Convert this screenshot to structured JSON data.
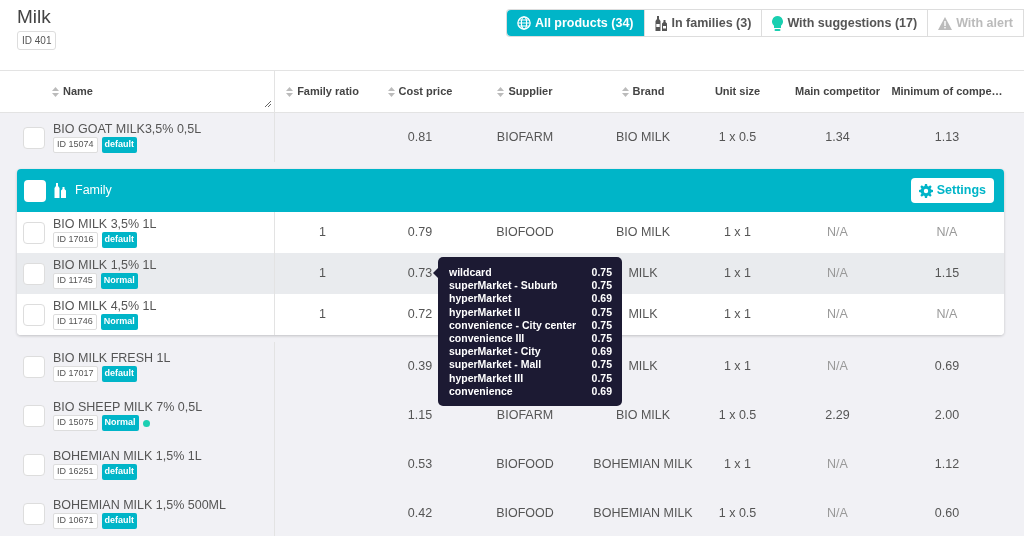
{
  "title": "Milk",
  "id_tag": "ID 401",
  "tabs": [
    {
      "label": "All products (34)",
      "selected": true,
      "disabled": false
    },
    {
      "label": "In families (3)",
      "selected": false,
      "disabled": false
    },
    {
      "label": "With suggestions (17)",
      "selected": false,
      "disabled": false
    },
    {
      "label": "With alert",
      "selected": false,
      "disabled": true
    }
  ],
  "columns": [
    "Name",
    "Family ratio",
    "Cost price",
    "Supplier",
    "Brand",
    "Unit size",
    "Main competitor",
    "Minimum of compe…"
  ],
  "sortable": [
    true,
    true,
    true,
    true,
    true,
    false,
    false,
    false
  ],
  "rows": [
    {
      "kind": "product",
      "checked": false,
      "name": "BIO GOAT MILK3,5% 0,5L",
      "id": "ID 15074",
      "badge": "default",
      "highlighted": false,
      "cells": [
        null,
        "0.81",
        "BIOFARM",
        "BIO MILK",
        "1 x 0.5",
        "1.34",
        "1.13"
      ]
    },
    {
      "kind": "family",
      "checked": false,
      "label": "Family",
      "button": "Settings",
      "children": [
        {
          "kind": "product",
          "checked": false,
          "name": "BIO MILK 3,5% 1L",
          "id": "ID 17016",
          "badge": "default",
          "highlighted": false,
          "cells": [
            "1",
            "0.79",
            "BIOFOOD",
            "BIO MILK",
            "1 x 1",
            {
              "text": "N/A",
              "muted": true
            },
            {
              "text": "N/A",
              "muted": true
            }
          ]
        },
        {
          "kind": "product",
          "checked": false,
          "name": "BIO MILK 1,5% 1L",
          "id": "ID 11745",
          "badge": "Normal",
          "highlighted": true,
          "cells": [
            "1",
            "0.73",
            null,
            "MILK",
            "1 x 1",
            {
              "text": "N/A",
              "muted": true
            },
            "1.15"
          ]
        },
        {
          "kind": "product",
          "checked": false,
          "name": "BIO MILK 4,5% 1L",
          "id": "ID 11746",
          "badge": "Normal",
          "highlighted": false,
          "cells": [
            "1",
            "0.72",
            null,
            "MILK",
            "1 x 1",
            {
              "text": "N/A",
              "muted": true
            },
            {
              "text": "N/A",
              "muted": true
            }
          ]
        }
      ]
    },
    {
      "kind": "product",
      "checked": false,
      "name": "BIO MILK FRESH 1L",
      "id": "ID 17017",
      "badge": "default",
      "highlighted": false,
      "cells": [
        null,
        "0.39",
        null,
        "MILK",
        "1 x 1",
        {
          "text": "N/A",
          "muted": true
        },
        "0.69"
      ]
    },
    {
      "kind": "product",
      "checked": false,
      "name": "BIO SHEEP MILK 7% 0,5L",
      "id": "ID 15075",
      "badge": "Normal",
      "color": "#1ccfb2",
      "highlighted": false,
      "cells": [
        null,
        "1.15",
        "BIOFARM",
        "BIO MILK",
        "1 x 0.5",
        "2.29",
        "2.00"
      ]
    },
    {
      "kind": "product",
      "checked": false,
      "name": "BOHEMIAN MILK 1,5% 1L",
      "id": "ID 16251",
      "badge": "default",
      "highlighted": false,
      "cells": [
        null,
        "0.53",
        "BIOFOOD",
        "BOHEMIAN MILK",
        "1 x 1",
        {
          "text": "N/A",
          "muted": true
        },
        "1.12"
      ]
    },
    {
      "kind": "product",
      "checked": false,
      "name": "BOHEMIAN MILK 1,5% 500ML",
      "id": "ID 10671",
      "badge": "default",
      "highlighted": false,
      "cells": [
        null,
        "0.42",
        "BIOFOOD",
        "BOHEMIAN MILK",
        "1 x 0.5",
        {
          "text": "N/A",
          "muted": true
        },
        "0.60"
      ]
    }
  ],
  "tooltip": [
    {
      "label": "wildcard",
      "value": "0.75"
    },
    {
      "label": "superMarket - Suburb",
      "value": "0.75"
    },
    {
      "label": "hyperMarket",
      "value": "0.69"
    },
    {
      "label": "hyperMarket II",
      "value": "0.75"
    },
    {
      "label": "convenience - City center",
      "value": "0.75"
    },
    {
      "label": "convenience III",
      "value": "0.75"
    },
    {
      "label": "superMarket - City",
      "value": "0.69"
    },
    {
      "label": "superMarket - Mall",
      "value": "0.75"
    },
    {
      "label": "hyperMarket III",
      "value": "0.75"
    },
    {
      "label": "convenience",
      "value": "0.69"
    }
  ]
}
